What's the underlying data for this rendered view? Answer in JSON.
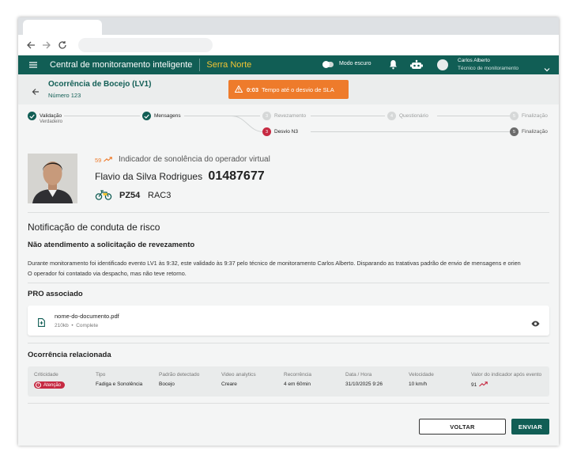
{
  "appbar": {
    "title": "Central de monitoramento inteligente",
    "region": "Serra Norte",
    "dark_mode_label": "Modo escuro",
    "user_name": "Carlos Alberto",
    "user_role": "Técnico de monitoramento"
  },
  "header": {
    "title": "Ocorrência de Bocejo (LV1)",
    "number": "Número 123",
    "sla_time": "0:03",
    "sla_text": "Tempo até o desvio de SLA"
  },
  "stepper": {
    "steps": [
      {
        "n": "",
        "label": "Validação",
        "sub": "Verdadeiro",
        "state": "done"
      },
      {
        "n": "",
        "label": "Mensagens",
        "sub": "",
        "state": "done"
      },
      {
        "n": "3",
        "label": "Revezamento",
        "sub": "",
        "state": "pending"
      },
      {
        "n": "4",
        "label": "Questionário",
        "sub": "",
        "state": "pending"
      },
      {
        "n": "5",
        "label": "Finalização",
        "sub": "",
        "state": "pending"
      },
      {
        "n": "3",
        "label": "Desvio N3",
        "sub": "",
        "state": "active"
      },
      {
        "n": "5",
        "label": "Finalização",
        "sub": "",
        "state": "dark"
      }
    ]
  },
  "driver": {
    "score": "59",
    "score_label": "Indicador de sonolência do operador virtual",
    "name": "Flavio da Silva Rodrigues",
    "id": "01487677",
    "plate": "PZ54",
    "code": "RAC3"
  },
  "notification": {
    "heading": "Notificação de conduta de risco",
    "subheading": "Não atendimento a solicitação de revezamento",
    "line1": "Durante monitoramento foi identificado evento LV1 às 9:32, este validado às 9:37 pelo técnico de monitoramento Carlos Alberto. Disparando as tratativas padrão de envio de mensagens e orien",
    "line2": "O operador foi contatado via despacho, mas não teve retorno."
  },
  "pro": {
    "heading": "PRO associado",
    "file_name": "nome-do-documento.pdf",
    "file_size": "210kb",
    "file_status": "Complete"
  },
  "related": {
    "heading": "Ocorrência relacionada",
    "columns": {
      "criticidade": "Criticidade",
      "tipo": "Tipo",
      "padrao": "Padrão detectado",
      "video": "Video analytics",
      "recorrencia": "Recorrência",
      "data": "Data / Hora",
      "velocidade": "Velocidade",
      "valor": "Valor do indicador após evento"
    },
    "values": {
      "criticidade": "Atenção",
      "tipo": "Fadiga e Sonolência",
      "padrao": "Bocejo",
      "video": "Creare",
      "recorrencia": "4 em 60min",
      "data": "31/10/2025 9:26",
      "velocidade": "10 km/h",
      "valor": "91"
    }
  },
  "actions": {
    "back": "VOLTAR",
    "send": "ENVIAR"
  },
  "colors": {
    "primary": "#115e55",
    "accent": "#f2c433",
    "warning": "#ee7b2b",
    "danger": "#c62a42"
  }
}
